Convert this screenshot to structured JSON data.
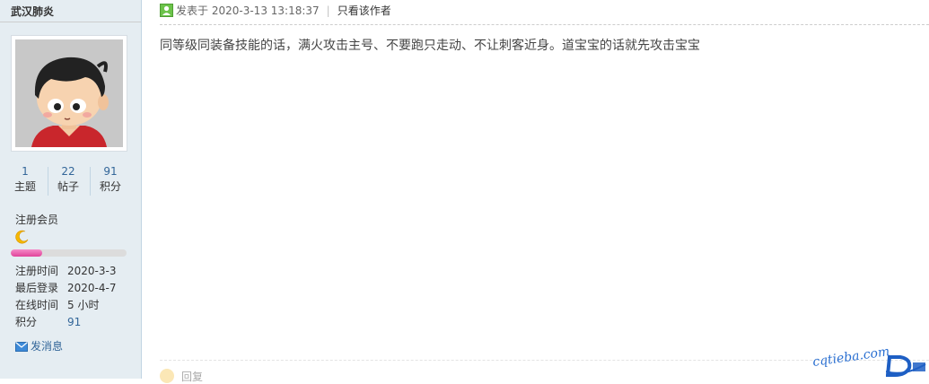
{
  "profile": {
    "username": "武汉肺炎",
    "stats": [
      {
        "value": "1",
        "label": "主题"
      },
      {
        "value": "22",
        "label": "帖子"
      },
      {
        "value": "91",
        "label": "积分"
      }
    ],
    "group": "注册会员",
    "level_progress_percent": 27,
    "info": [
      {
        "key": "注册时间",
        "value": "2020-3-3"
      },
      {
        "key": "最后登录",
        "value": "2020-4-7"
      },
      {
        "key": "在线时间",
        "value": "5 小时"
      },
      {
        "key": "积分",
        "value": "91"
      }
    ],
    "send_message": "发消息"
  },
  "post": {
    "posted_prefix": "发表于",
    "posted_time": "2020-3-13 13:18:37",
    "separator": "|",
    "author_only": "只看该作者",
    "content": "同等级同装备技能的话，满火攻击主号、不要跑只走动、不让刺客近身。道宝宝的话就先攻击宝宝",
    "reply_label": "回复"
  },
  "watermark": {
    "text": "cqtieba.com"
  },
  "colors": {
    "sidebar_bg": "#e5edf2",
    "link": "#336699",
    "progress": "#e0439a"
  }
}
